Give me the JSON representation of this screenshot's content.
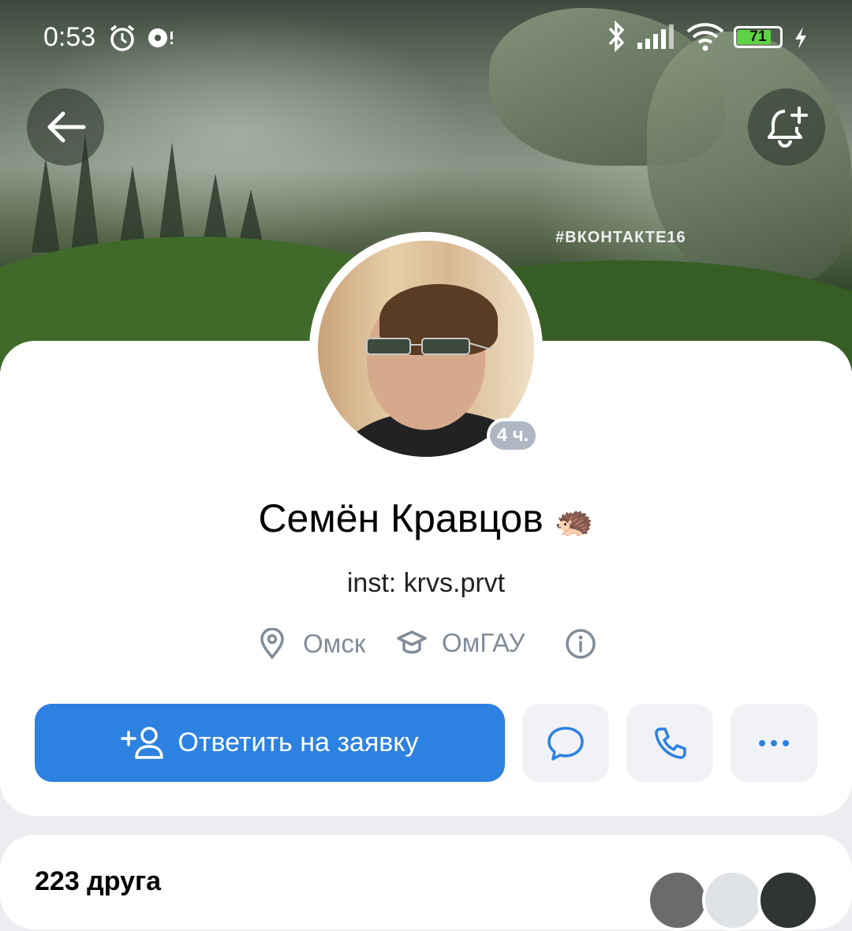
{
  "statusbar": {
    "time": "0:53",
    "battery": "71"
  },
  "cover": {
    "hashtag": "#ВКОНТАКТЕ16"
  },
  "profile": {
    "name": "Семён Кравцов",
    "name_emoji": "🦔",
    "online_badge": "4 ч.",
    "status": "inst: krvs.prvt",
    "city": "Омск",
    "university": "ОмГАУ"
  },
  "actions": {
    "primary_label": "Ответить на заявку"
  },
  "friends": {
    "title": "223 друга"
  },
  "colors": {
    "accent": "#2d81e0",
    "secondary_text": "#818c99",
    "button_bg": "#f0f2f5"
  }
}
